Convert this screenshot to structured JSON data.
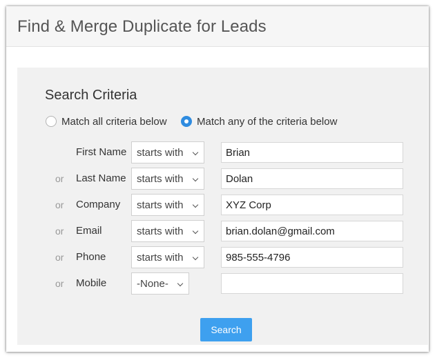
{
  "header": {
    "title": "Find & Merge Duplicate for Leads"
  },
  "search": {
    "section_title": "Search Criteria",
    "match_options": [
      {
        "label": "Match all criteria below",
        "selected": false
      },
      {
        "label": "Match any of the criteria below",
        "selected": true
      }
    ],
    "or_label": "or",
    "rows": [
      {
        "label": "First Name",
        "operator": "starts with",
        "value": "Brian"
      },
      {
        "label": "Last Name",
        "operator": "starts with",
        "value": "Dolan"
      },
      {
        "label": "Company",
        "operator": "starts with",
        "value": "XYZ Corp"
      },
      {
        "label": "Email",
        "operator": "starts with",
        "value": "brian.dolan@gmail.com"
      },
      {
        "label": "Phone",
        "operator": "starts with",
        "value": "985-555-4796"
      },
      {
        "label": "Mobile",
        "operator": "-None-",
        "value": ""
      }
    ],
    "button_label": "Search"
  },
  "colors": {
    "accent": "#3ea0ef",
    "radio_selected": "#2f8ce0",
    "panel_bg": "#f1f1f1"
  },
  "icons": {
    "select_arrow": "chevron-down-icon"
  }
}
